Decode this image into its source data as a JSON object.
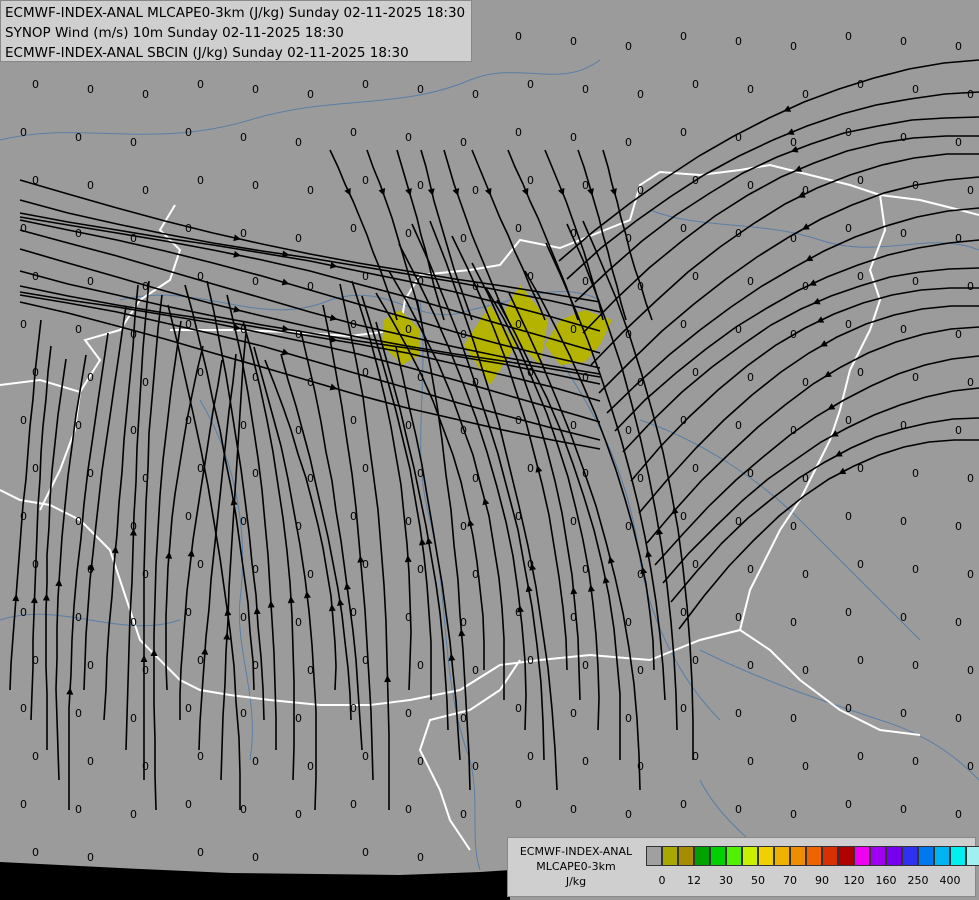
{
  "titles": [
    "ECMWF-INDEX-ANAL MLCAPE0-3km (J/kg) Sunday 02-11-2025 18:30",
    "SYNOP Wind (m/s) 10m Sunday 02-11-2025 18:30",
    "ECMWF-INDEX-ANAL SBCIN (J/kg) Sunday 02-11-2025 18:30"
  ],
  "legend": {
    "line1": "ECMWF-INDEX-ANAL",
    "line2": "MLCAPE0-3km",
    "unit": "J/kg",
    "colors": [
      "#a0a0a0",
      "#a8a800",
      "#a88c00",
      "#00a000",
      "#00d000",
      "#50f000",
      "#c8f000",
      "#f0d000",
      "#f0b000",
      "#f08c00",
      "#f06400",
      "#d83000",
      "#b00000",
      "#f000f0",
      "#a000f0",
      "#7800f0",
      "#3030f0",
      "#0078f0",
      "#00b4f0",
      "#00f0f0",
      "#a0f0f0",
      "#ffffff"
    ],
    "ticks": [
      {
        "label": "0",
        "i": 1
      },
      {
        "label": "12",
        "i": 3
      },
      {
        "label": "30",
        "i": 5
      },
      {
        "label": "50",
        "i": 7
      },
      {
        "label": "70",
        "i": 9
      },
      {
        "label": "90",
        "i": 11
      },
      {
        "label": "120",
        "i": 13
      },
      {
        "label": "160",
        "i": 15
      },
      {
        "label": "250",
        "i": 17
      },
      {
        "label": "400",
        "i": 19
      }
    ]
  },
  "map_colors": {
    "background": "#9b9b9b",
    "rivers": "#5a7ea6",
    "borders": "#ffffff",
    "streamlines": "#000000",
    "cape_fill": "#b4b400"
  },
  "value_label": "0"
}
